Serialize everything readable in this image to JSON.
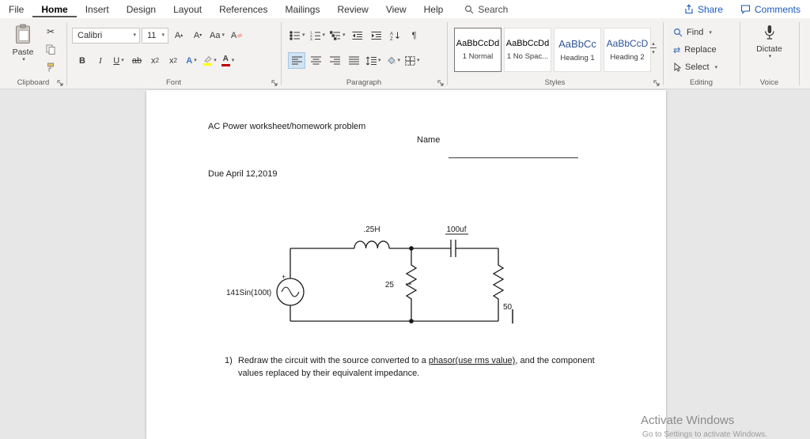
{
  "tabbar": {
    "tabs": [
      "File",
      "Home",
      "Insert",
      "Design",
      "Layout",
      "References",
      "Mailings",
      "Review",
      "View",
      "Help"
    ],
    "search": "Search",
    "share": "Share",
    "comments": "Comments"
  },
  "ribbon": {
    "clipboard": {
      "paste": "Paste",
      "label": "Clipboard"
    },
    "font": {
      "name": "Calibri",
      "size": "11",
      "grow": "A",
      "shrink": "A",
      "change_case": "Aa",
      "clear": "A",
      "bold": "B",
      "italic": "I",
      "underline": "U",
      "strike": "ab",
      "sub_x": "x",
      "sub_n": "2",
      "sup_x": "x",
      "sup_n": "2",
      "effects": "A",
      "color": "A",
      "label": "Font"
    },
    "paragraph": {
      "pilcrow": "¶",
      "label": "Paragraph"
    },
    "styles": {
      "cards": [
        {
          "preview": "AaBbCcDd",
          "name": "1 Normal"
        },
        {
          "preview": "AaBbCcDd",
          "name": "1 No Spac..."
        },
        {
          "preview": "AaBbCc",
          "name": "Heading 1"
        },
        {
          "preview": "AaBbCcD",
          "name": "Heading 2"
        }
      ],
      "label": "Styles"
    },
    "editing": {
      "find": "Find",
      "replace": "Replace",
      "select": "Select",
      "label": "Editing"
    },
    "voice": {
      "dictate": "Dictate",
      "label": "Voice"
    }
  },
  "document": {
    "title": "AC Power worksheet/homework problem",
    "name_label": "Name",
    "due_date": "Due April 12,2019",
    "circuit": {
      "source": "141Sin(100t)",
      "polarity": "+",
      "inductor": ".25H",
      "capacitor": "100uf",
      "resistor_middle": "25",
      "resistor_right": "50"
    },
    "q1_number": "1)",
    "q1_part1": "Redraw the circuit with the source converted to a ",
    "q1_underlined": "phasor(use rms value)",
    "q1_part2": ", and the component",
    "q1_line2": "values replaced by their equivalent impedance."
  },
  "watermark": {
    "title": "Activate Windows",
    "subtitle": "Go to Settings to activate Windows."
  },
  "colors": {
    "accent_blue": "#185abd",
    "heading_blue": "#2f5496",
    "highlight_yellow": "#ffff00",
    "font_color_red": "#c00000"
  }
}
